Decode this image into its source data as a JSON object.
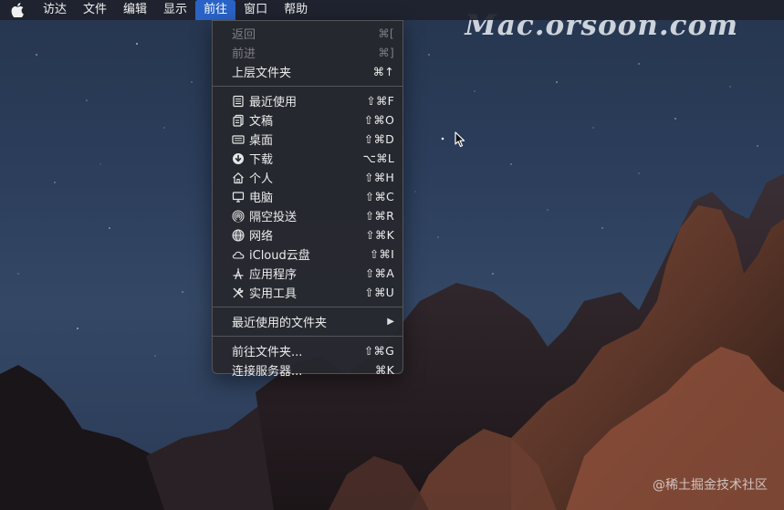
{
  "menubar": {
    "apple_icon": "apple-logo",
    "items": [
      "访达",
      "文件",
      "编辑",
      "显示",
      "前往",
      "窗口",
      "帮助"
    ],
    "active_item": "前往",
    "active_color": "#2a63c8"
  },
  "watermark": {
    "brand": "Mac.orsoon.com",
    "footer": "@稀土掘金技术社区"
  },
  "go_menu": {
    "nav": [
      {
        "label": "返回",
        "shortcut": "⌘[",
        "disabled": true
      },
      {
        "label": "前进",
        "shortcut": "⌘]",
        "disabled": true
      },
      {
        "label": "上层文件夹",
        "shortcut": "⌘↑",
        "disabled": false
      }
    ],
    "places": [
      {
        "label": "最近使用",
        "shortcut": "⇧⌘F",
        "icon": "recents-icon"
      },
      {
        "label": "文稿",
        "shortcut": "⇧⌘O",
        "icon": "documents-icon"
      },
      {
        "label": "桌面",
        "shortcut": "⇧⌘D",
        "icon": "desktop-icon"
      },
      {
        "label": "下载",
        "shortcut": "⌥⌘L",
        "icon": "downloads-icon"
      },
      {
        "label": "个人",
        "shortcut": "⇧⌘H",
        "icon": "home-icon"
      },
      {
        "label": "电脑",
        "shortcut": "⇧⌘C",
        "icon": "computer-icon"
      },
      {
        "label": "隔空投送",
        "shortcut": "⇧⌘R",
        "icon": "airdrop-icon"
      },
      {
        "label": "网络",
        "shortcut": "⇧⌘K",
        "icon": "network-icon"
      },
      {
        "label": "iCloud云盘",
        "shortcut": "⇧⌘I",
        "icon": "icloud-icon"
      },
      {
        "label": "应用程序",
        "shortcut": "⇧⌘A",
        "icon": "applications-icon"
      },
      {
        "label": "实用工具",
        "shortcut": "⇧⌘U",
        "icon": "utilities-icon"
      }
    ],
    "recent_folders": {
      "label": "最近使用的文件夹",
      "submenu_icon": "chevron-right-icon"
    },
    "go_actions": [
      {
        "label": "前往文件夹...",
        "shortcut": "⇧⌘G"
      },
      {
        "label": "连接服务器...",
        "shortcut": "⌘K"
      }
    ]
  }
}
